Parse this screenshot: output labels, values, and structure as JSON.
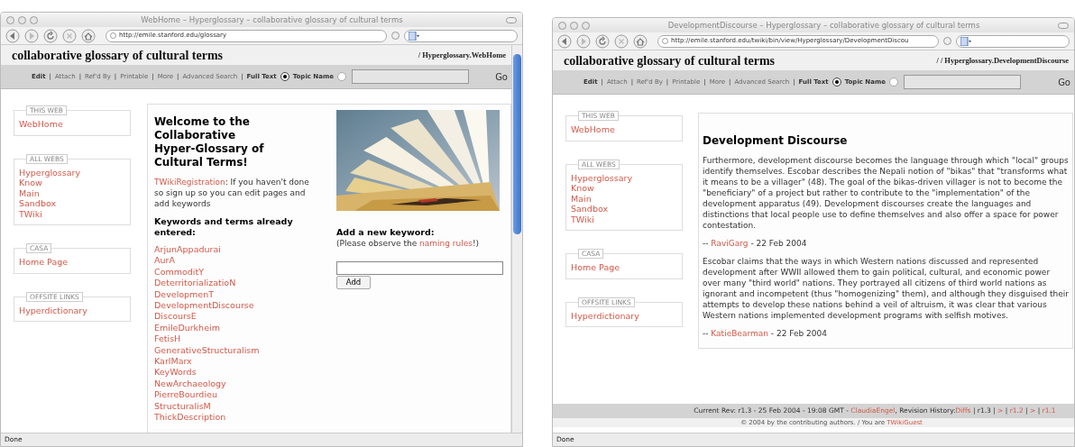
{
  "windows": [
    {
      "kind": "home",
      "title": "WebHome – Hyperglossary – collaborative glossary of cultural terms",
      "url": "http://emile.stanford.edu/glossary",
      "site_title": "collaborative glossary of cultural terms",
      "breadcrumb": "/ Hyperglossary.WebHome",
      "actions": [
        "Edit",
        "Attach",
        "Ref'd By",
        "Printable",
        "More",
        "Advanced Search"
      ],
      "separator": "|",
      "search_options": [
        {
          "label": "Full Text",
          "selected": true
        },
        {
          "label": "Topic Name",
          "selected": false
        }
      ],
      "go": "Go",
      "sidebar": [
        {
          "heading": "THIS WEB",
          "links": [
            "WebHome"
          ]
        },
        {
          "heading": "ALL WEBS",
          "links": [
            "Hyperglossary",
            "Know",
            "Main",
            "Sandbox",
            "TWiki"
          ]
        },
        {
          "heading": "CASA",
          "links": [
            "Home Page"
          ]
        },
        {
          "heading": "OFFSITE LINKS",
          "links": [
            "Hyperdictionary"
          ]
        }
      ],
      "main": {
        "heading": "Welcome to the Collaborative Hyper-Glossary of Cultural Terms!",
        "intro": [
          {
            "kind": "link",
            "text": "TWikiRegistration"
          },
          {
            "kind": "text",
            "text": ": If you haven't done so sign up so you can edit pages and add keywords"
          }
        ],
        "keywords_heading": "Keywords and terms already entered:",
        "keywords": [
          "ArjunAppadurai",
          "AurA",
          "CommoditY",
          "DeterritorializatioN",
          "DevelopmenT",
          "DevelopmentDiscourse",
          "DiscoursE",
          "EmileDurkheim",
          "FetisH",
          "GenerativeStructuralism",
          "KarlMarx",
          "KeyWords",
          "NewArchaeology",
          "PierreBourdieu",
          "StructuralisM",
          "ThickDescription"
        ],
        "add_heading": "Add a new keyword:",
        "add_note": [
          {
            "kind": "text",
            "text": "(Please observe the "
          },
          {
            "kind": "link",
            "text": "naming rules"
          },
          {
            "kind": "text",
            "text": "!)"
          }
        ],
        "add_button": "Add"
      },
      "status": "Done"
    },
    {
      "kind": "topic",
      "title": "DevelopmentDiscourse – Hyperglossary – collaborative glossary of cultural terms",
      "url": "http://emile.stanford.edu/twiki/bin/view/Hyperglossary/DevelopmentDiscou",
      "site_title": "collaborative glossary of cultural terms",
      "breadcrumb": "/ / Hyperglossary.DevelopmentDiscourse",
      "actions": [
        "Edit",
        "Attach",
        "Ref'd By",
        "Printable",
        "More",
        "Advanced Search"
      ],
      "separator": "|",
      "search_options": [
        {
          "label": "Full Text",
          "selected": true
        },
        {
          "label": "Topic Name",
          "selected": false
        }
      ],
      "go": "Go",
      "sidebar": [
        {
          "heading": "THIS WEB",
          "links": [
            "WebHome"
          ]
        },
        {
          "heading": "ALL WEBS",
          "links": [
            "Hyperglossary",
            "Know",
            "Main",
            "Sandbox",
            "TWiki"
          ]
        },
        {
          "heading": "CASA",
          "links": [
            "Home Page"
          ]
        },
        {
          "heading": "OFFSITE LINKS",
          "links": [
            "Hyperdictionary"
          ]
        }
      ],
      "main": {
        "heading": "Development Discourse",
        "posts": [
          {
            "text": "Furthermore, development discourse becomes the language through which \"local\" groups identify themselves. Escobar describes the Nepali notion of \"bikas\" that \"transforms what it means to be a villager\" (48). The goal of the bikas-driven villager is not to become the \"beneficiary\" of a project but rather to contribute to the \"implementation\" of the development apparatus (49). Development discourses create the languages and distinctions that local people use to define themselves and also offer a space for power contestation.",
            "signature": [
              {
                "kind": "text",
                "text": "-- "
              },
              {
                "kind": "link",
                "text": "RaviGarg"
              },
              {
                "kind": "text",
                "text": " - 22 Feb 2004"
              }
            ]
          },
          {
            "text": "Escobar claims that the ways in which Western nations discussed and represented development after WWII allowed them to gain political, cultural, and economic power over many \"third world\" nations. They portrayed all citizens of third world nations as ignorant and incompetent (thus \"homogenizing\" them), and although they disguised their attempts to develop these nations behind a veil of altruism, it was clear that various Western nations implemented development programs with selfish motives.",
            "signature": [
              {
                "kind": "text",
                "text": "-- "
              },
              {
                "kind": "link",
                "text": "KatieBearman"
              },
              {
                "kind": "text",
                "text": " - 22 Feb 2004"
              }
            ]
          }
        ],
        "revision": [
          {
            "kind": "text",
            "text": "Current Rev: r1.3 - 25 Feb 2004 - 19:08 GMT - "
          },
          {
            "kind": "link",
            "text": "ClaudiaEngel"
          },
          {
            "kind": "text",
            "text": ", Revision History:"
          },
          {
            "kind": "link",
            "text": "Diffs"
          },
          {
            "kind": "text",
            "text": " | r1.3 | "
          },
          {
            "kind": "link",
            "text": ">"
          },
          {
            "kind": "text",
            "text": " | "
          },
          {
            "kind": "link",
            "text": "r1.2"
          },
          {
            "kind": "text",
            "text": " | "
          },
          {
            "kind": "link",
            "text": ">"
          },
          {
            "kind": "text",
            "text": " | "
          },
          {
            "kind": "link",
            "text": "r1.1"
          }
        ],
        "copyright": [
          {
            "kind": "text",
            "text": "© 2004 by the contributing authors. / You are "
          },
          {
            "kind": "link",
            "text": "TWikiGuest"
          }
        ]
      },
      "status": "Done"
    }
  ]
}
